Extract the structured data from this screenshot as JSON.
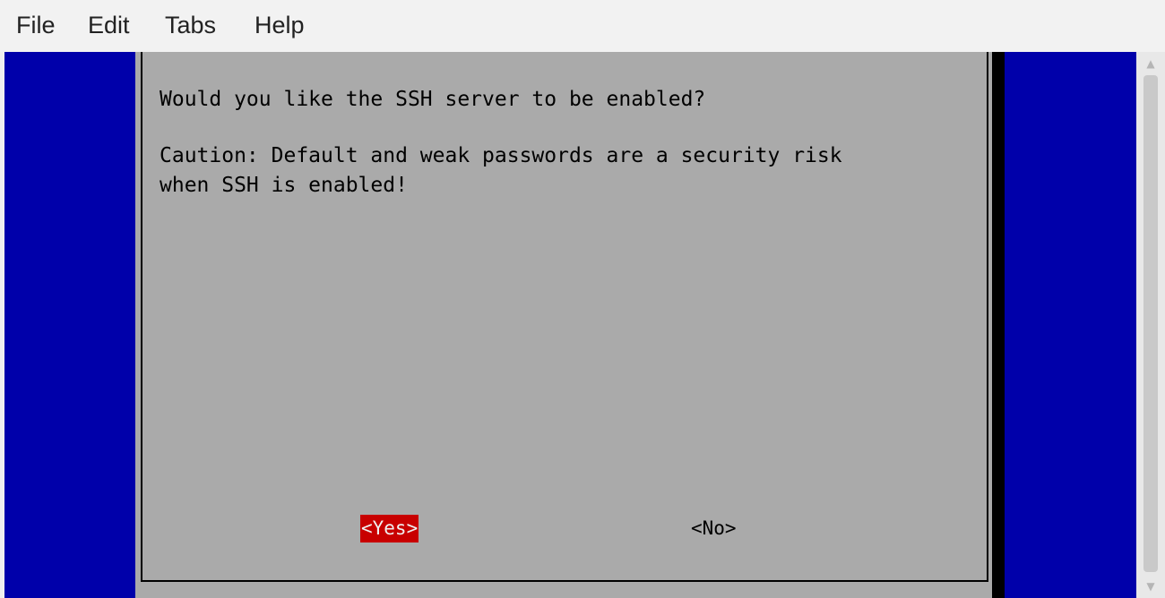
{
  "menu": {
    "file": "File",
    "edit": "Edit",
    "tabs": "Tabs",
    "help": "Help"
  },
  "dialog": {
    "question": "Would you like the SSH server to be enabled?",
    "caution_line1": "Caution: Default and weak passwords are a security risk",
    "caution_line2": "when SSH is enabled!",
    "yes_label": "<Yes>",
    "no_label": "<No>"
  },
  "scrollbar": {
    "up_icon": "arrow-up-icon",
    "down_icon": "arrow-down-icon"
  },
  "colors": {
    "terminal_background": "#0000aa",
    "dialog_background": "#aaaaaa",
    "selected_button": "#c80000"
  }
}
